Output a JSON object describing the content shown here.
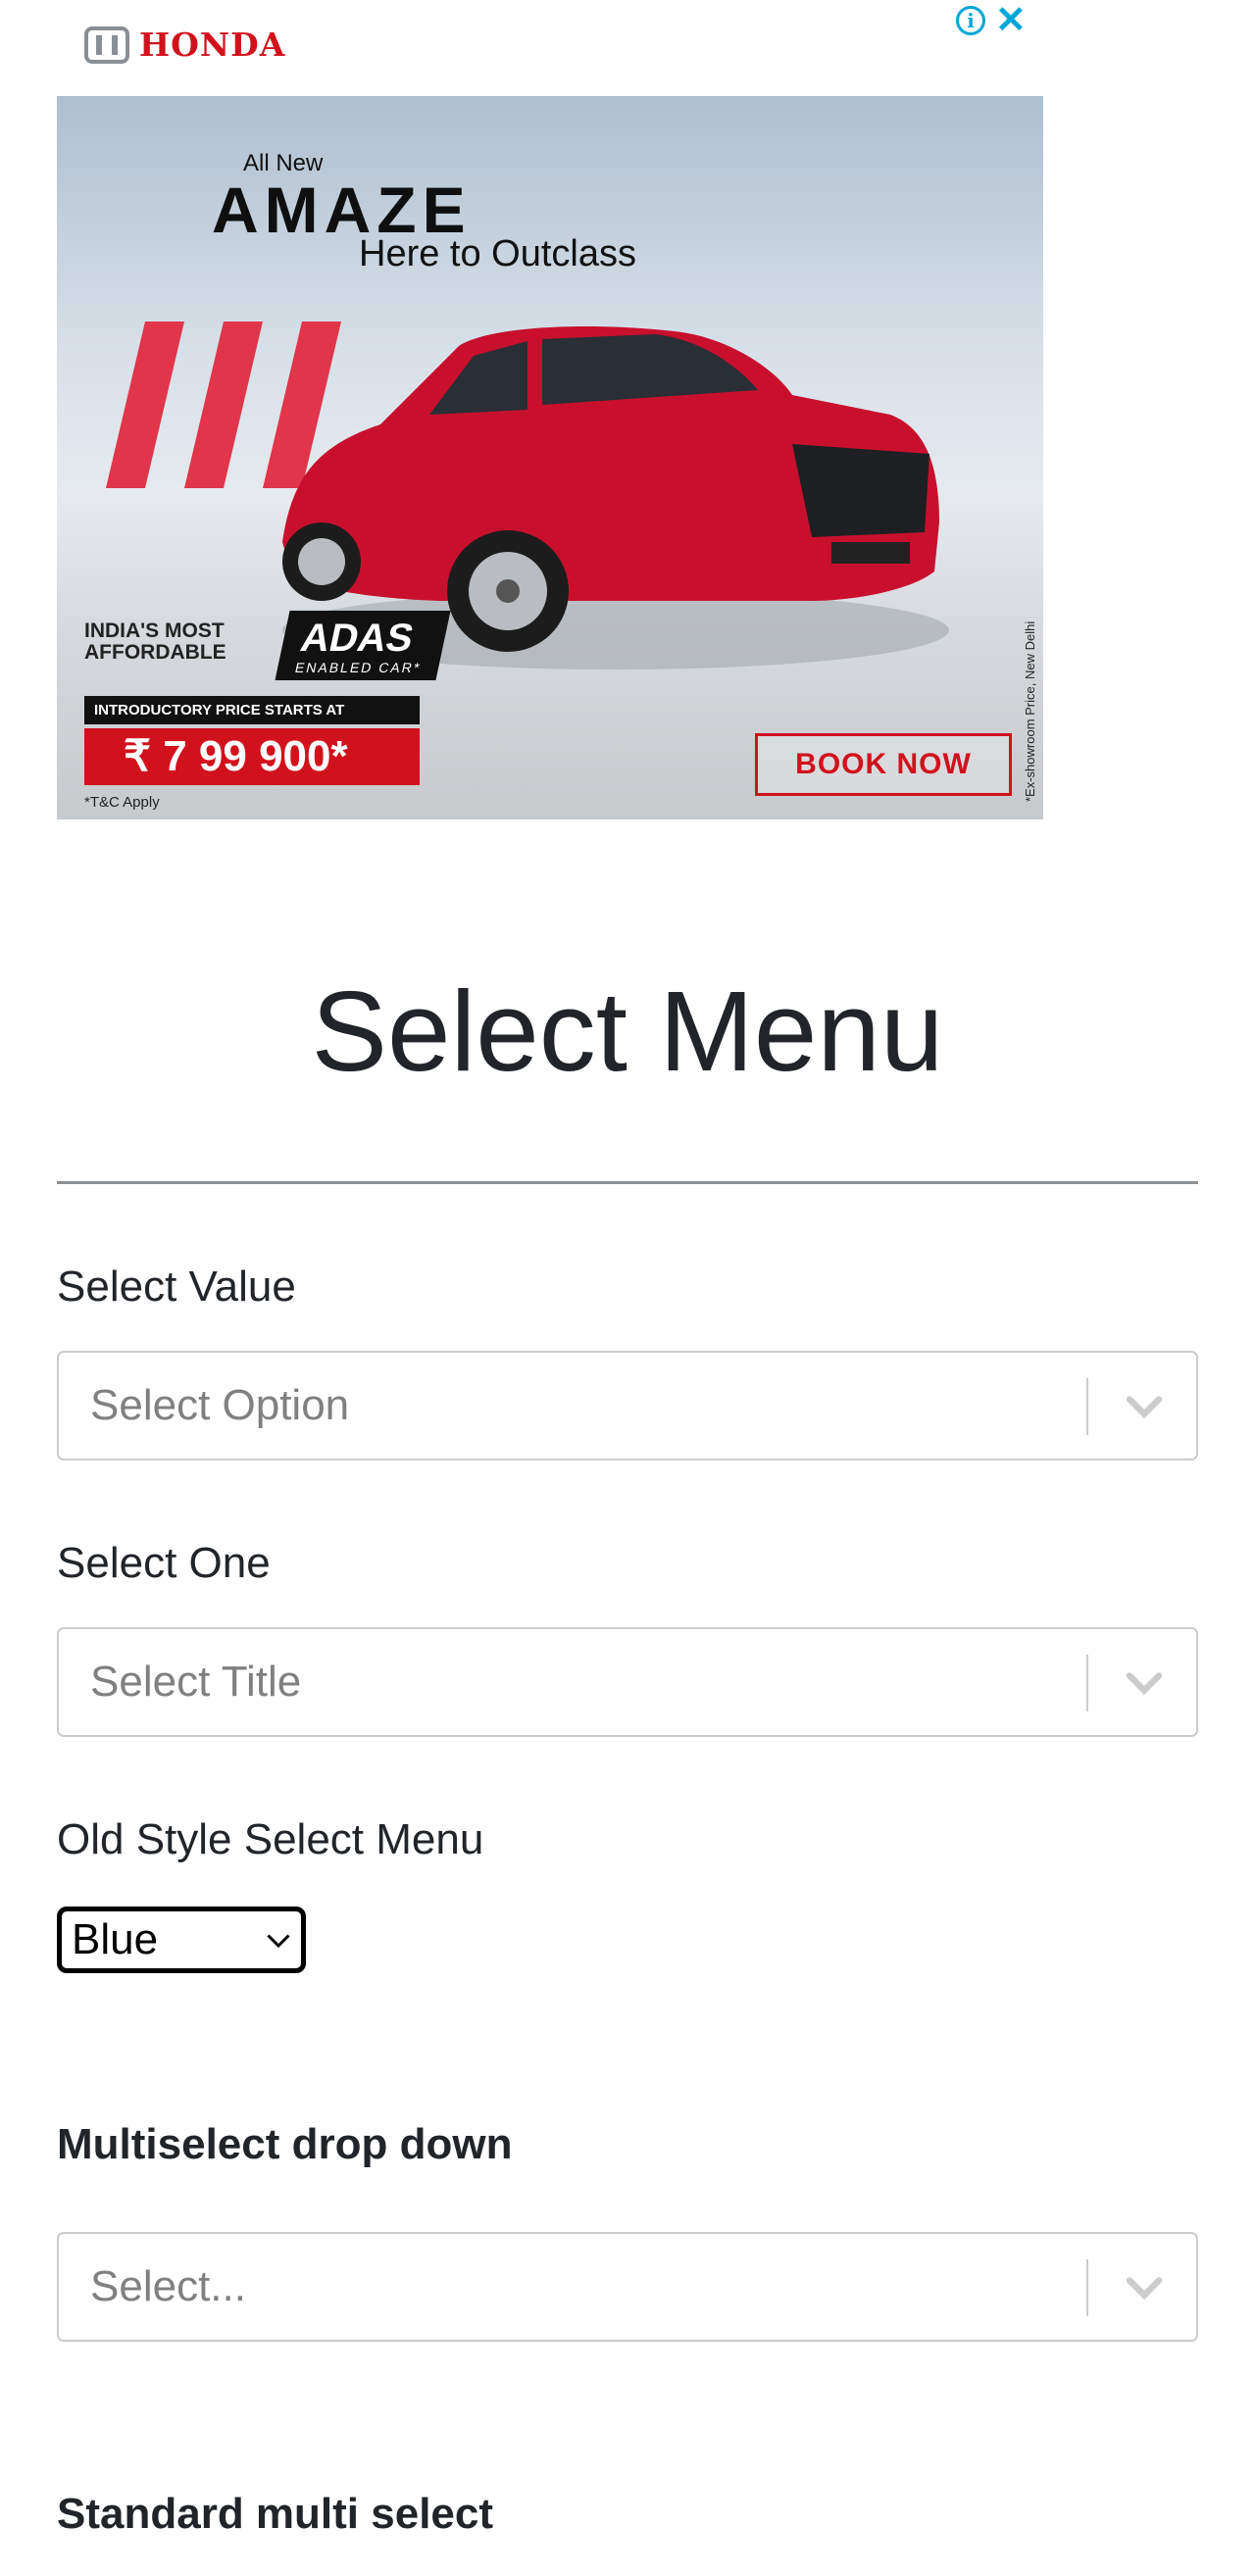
{
  "ad": {
    "brand": "HONDA",
    "all_new": "All New",
    "model": "AMAZE",
    "tagline": "Here to Outclass",
    "adas_lead": "INDIA'S MOST AFFORDABLE",
    "adas": "ADAS",
    "adas_sub": "ENABLED CAR*",
    "intro_price_label": "INTRODUCTORY PRICE STARTS AT",
    "price": "₹ 7 99 900*",
    "tc": "*T&C Apply",
    "book_now": "BOOK NOW",
    "fine_print": "*Ex-showroom Price, New Delhi",
    "info_icon": "info-icon",
    "close_icon": "close-icon"
  },
  "page": {
    "title": "Select Menu"
  },
  "fields": {
    "select_value": {
      "label": "Select Value",
      "placeholder": "Select Option"
    },
    "select_one": {
      "label": "Select One",
      "placeholder": "Select Title"
    },
    "old_style": {
      "label": "Old Style Select Menu",
      "selected": "Blue"
    },
    "multiselect": {
      "label": "Multiselect drop down",
      "placeholder": "Select..."
    },
    "standard_multi": {
      "label": "Standard multi select"
    }
  },
  "colors": {
    "honda_red": "#d1121d",
    "ad_accent": "#00a7d6",
    "placeholder": "#808080",
    "border": "#cccccc"
  }
}
